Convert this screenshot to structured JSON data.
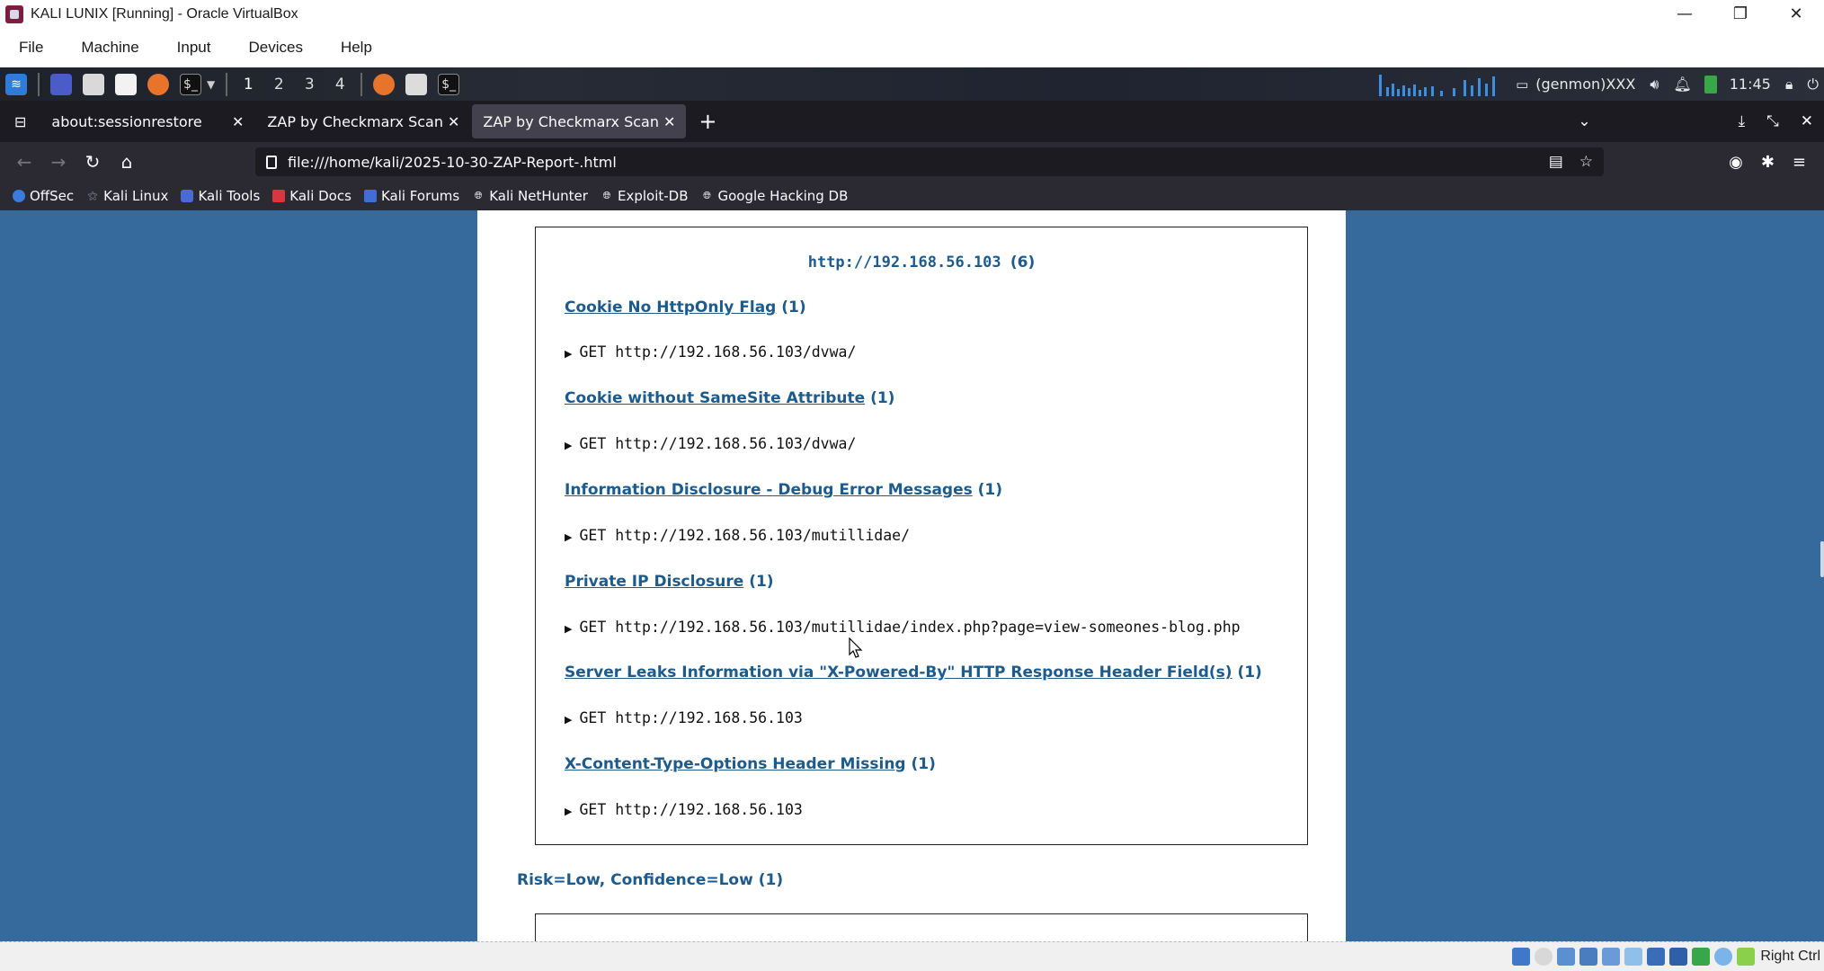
{
  "window": {
    "title": "KALI LUNIX [Running] - Oracle VirtualBox",
    "controls": {
      "minimize": "—",
      "restore": "❐",
      "close": "✕"
    }
  },
  "vbox_menu": [
    "File",
    "Machine",
    "Input",
    "Devices",
    "Help"
  ],
  "kali_panel": {
    "workspaces": [
      "1",
      "2",
      "3",
      "4"
    ],
    "active_workspace": "1",
    "genmon": "(genmon)XXX",
    "clock": "11:45"
  },
  "firefox": {
    "tabs": [
      {
        "label": "about:sessionrestore",
        "active": false
      },
      {
        "label": "ZAP by Checkmarx Scanning Report",
        "active": false
      },
      {
        "label": "ZAP by Checkmarx Scanning Report",
        "active": true
      }
    ],
    "new_tab": "+",
    "url": "file:///home/kali/2025-10-30-ZAP-Report-.html",
    "bookmarks": [
      "OffSec",
      "Kali Linux",
      "Kali Tools",
      "Kali Docs",
      "Kali Forums",
      "Kali NetHunter",
      "Exploit-DB",
      "Google Hacking DB"
    ]
  },
  "report": {
    "host": "http://192.168.56.103",
    "host_count": "(6)",
    "alerts": [
      {
        "name": "Cookie No HttpOnly Flag",
        "count": "(1)",
        "request": "GET http://192.168.56.103/dvwa/"
      },
      {
        "name": "Cookie without SameSite Attribute",
        "count": "(1)",
        "request": "GET http://192.168.56.103/dvwa/"
      },
      {
        "name": "Information Disclosure - Debug Error Messages",
        "count": "(1)",
        "request": "GET http://192.168.56.103/mutillidae/"
      },
      {
        "name": "Private IP Disclosure",
        "count": "(1)",
        "request": "GET http://192.168.56.103/mutillidae/index.php?page=view-someones-blog.php"
      },
      {
        "name": "Server Leaks Information via \"X-Powered-By\" HTTP Response Header Field(s)",
        "count": "(1)",
        "request": "GET http://192.168.56.103"
      },
      {
        "name": "X-Content-Type-Options Header Missing",
        "count": "(1)",
        "request": "GET http://192.168.56.103"
      }
    ],
    "risk_heading": "Risk=Low, Confidence=Low (1)"
  },
  "vbox_status": {
    "host_key": "Right Ctrl"
  },
  "colors": {
    "link": "#1d5b8c",
    "page_bg": "#366a9d",
    "tab_active": "#42414d"
  }
}
